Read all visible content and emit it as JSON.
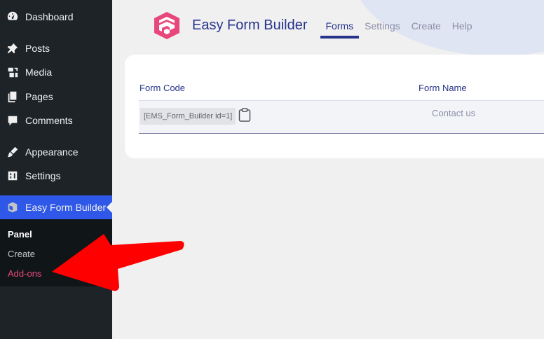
{
  "sidebar": {
    "items": [
      {
        "label": "Dashboard",
        "icon": "dashboard-icon"
      },
      {
        "label": "Posts",
        "icon": "pin-icon"
      },
      {
        "label": "Media",
        "icon": "media-icon"
      },
      {
        "label": "Pages",
        "icon": "pages-icon"
      },
      {
        "label": "Comments",
        "icon": "comments-icon"
      },
      {
        "label": "Appearance",
        "icon": "paintbrush-icon"
      },
      {
        "label": "Settings",
        "icon": "settings-icon"
      },
      {
        "label": "Easy Form Builder",
        "icon": "efb-icon"
      }
    ],
    "submenu": [
      "Panel",
      "Create",
      "Add-ons"
    ]
  },
  "header": {
    "brand": "Easy Form Builder",
    "tabs": [
      "Forms",
      "Settings",
      "Create",
      "Help"
    ]
  },
  "table": {
    "columns": [
      "Form Code",
      "Form Name"
    ],
    "rows": [
      {
        "code": "[EMS_Form_Builder id=1]",
        "name": "Contact us"
      }
    ]
  },
  "colors": {
    "accent": "#2f58e8",
    "brand": "#27348b",
    "logo": "#e8477c",
    "annotation": "#ff0000"
  }
}
